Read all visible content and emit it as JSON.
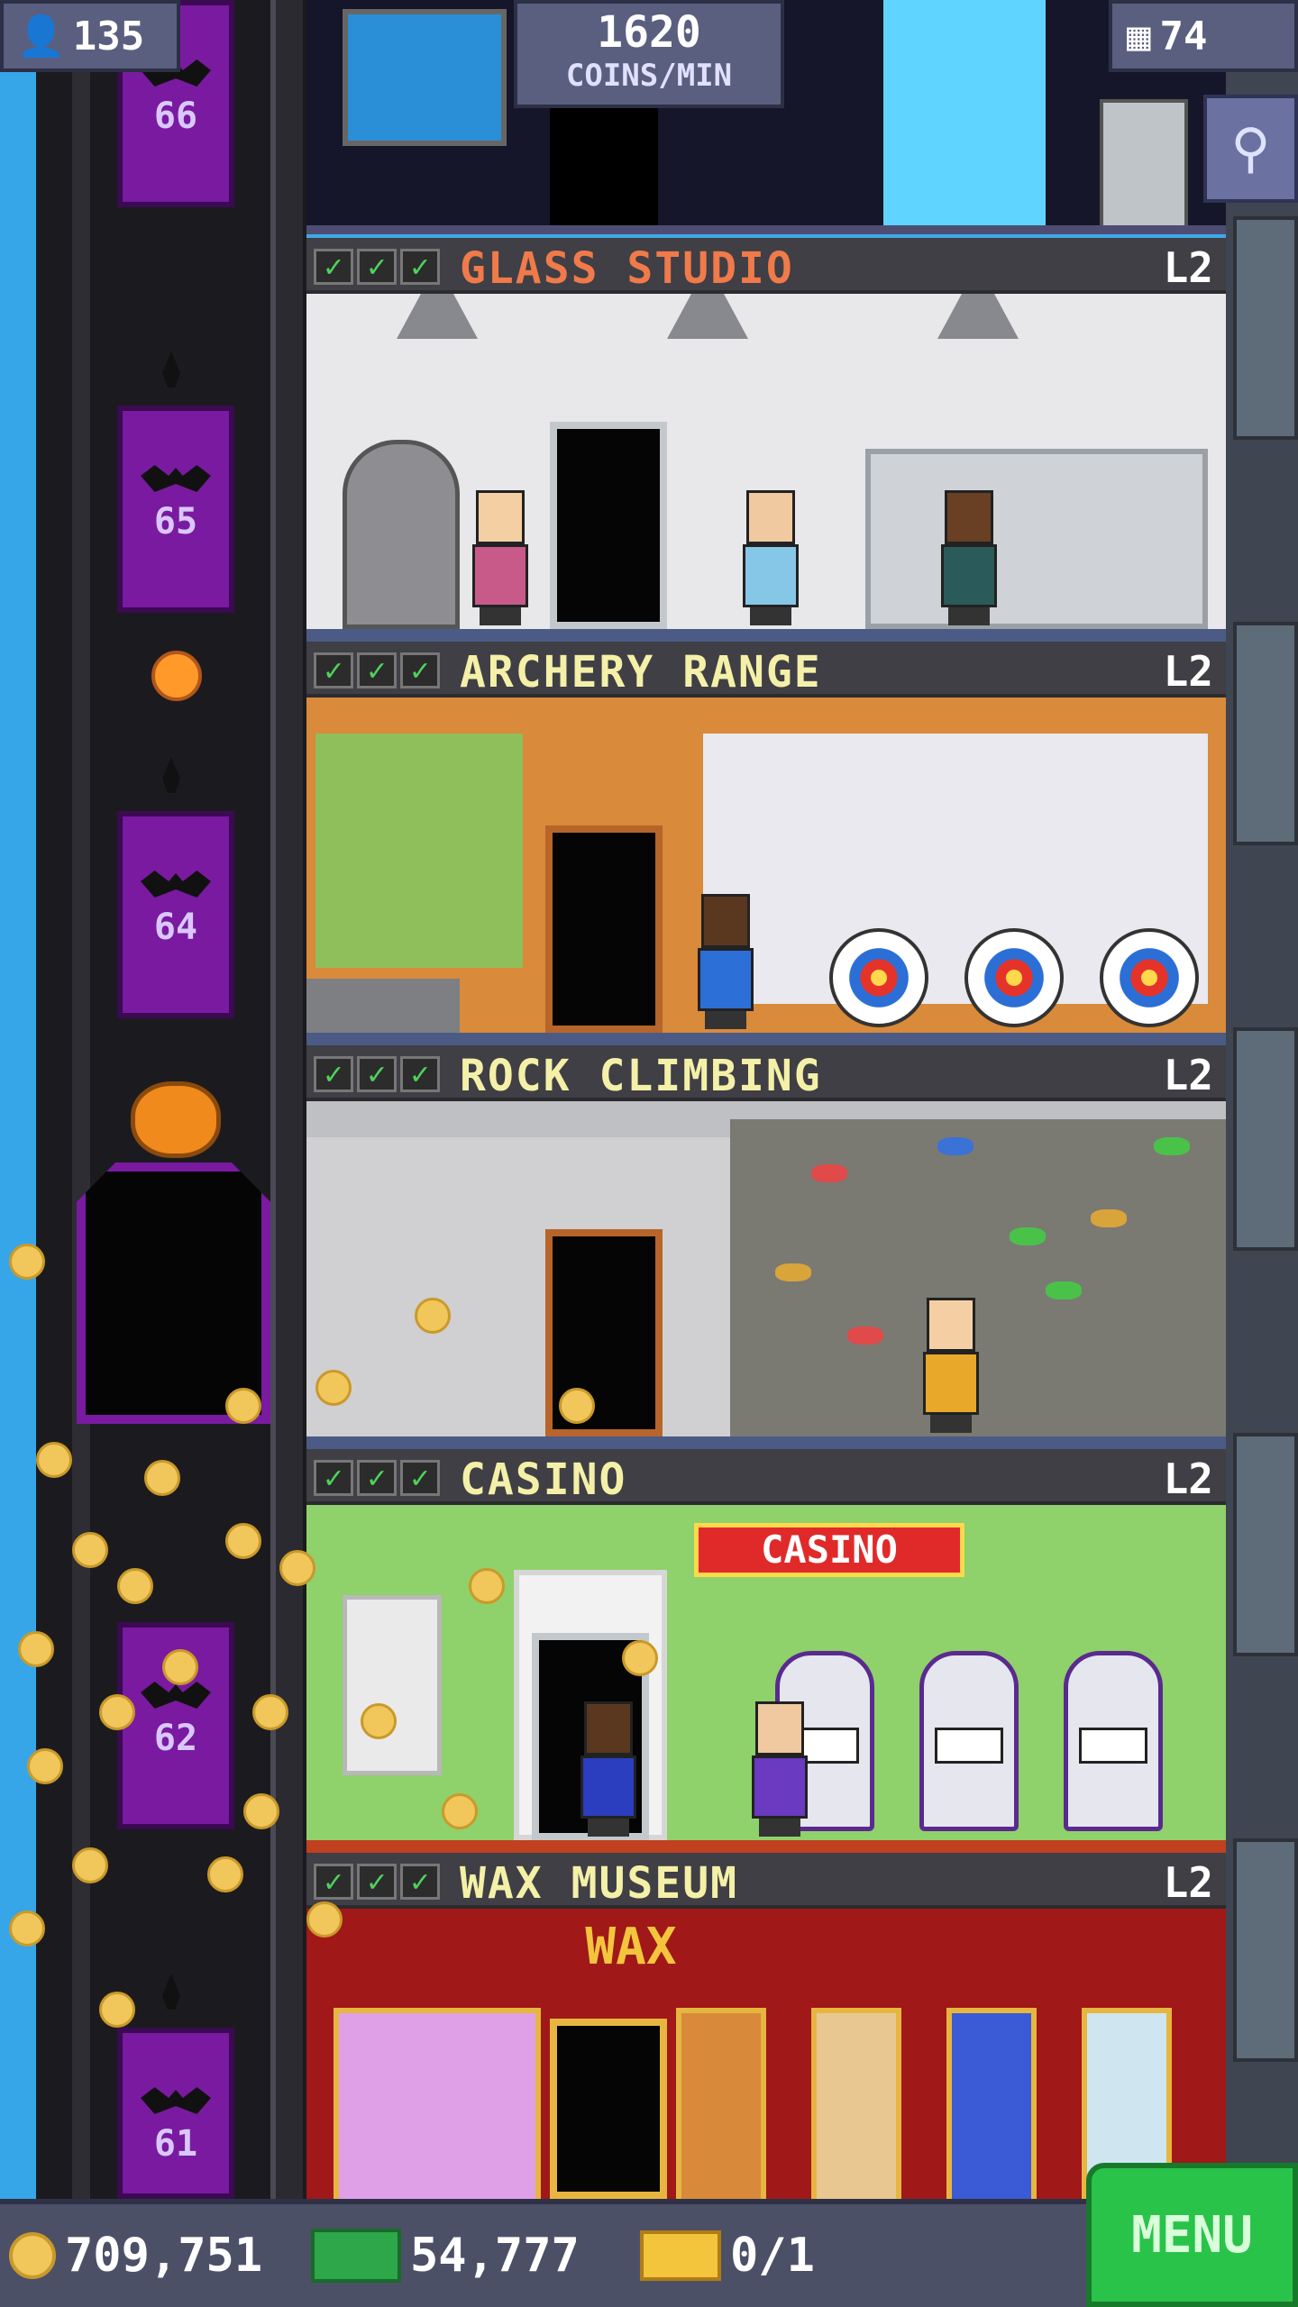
{
  "status": {
    "population": "135",
    "coin_rate_value": "1620",
    "coin_rate_label": "COINS/MIN",
    "floor_count": "74"
  },
  "elevator": {
    "floor_numbers": [
      "66",
      "65",
      "64",
      "62",
      "61"
    ]
  },
  "floors": [
    {
      "name": "GLASS STUDIO",
      "level": "L2",
      "name_color": "#f07a4a",
      "checks": 3
    },
    {
      "name": "ARCHERY RANGE",
      "level": "L2",
      "name_color": "#f4f0a8",
      "checks": 3
    },
    {
      "name": "ROCK CLIMBING",
      "level": "L2",
      "name_color": "#f4f0a8",
      "checks": 3
    },
    {
      "name": "CASINO",
      "level": "L2",
      "name_color": "#f4f0a8",
      "checks": 3,
      "sign": "CASINO"
    },
    {
      "name": "WAX MUSEUM",
      "level": "L2",
      "name_color": "#f4f0a8",
      "checks": 3,
      "sign": "WAX"
    }
  ],
  "bottom_bar": {
    "coins": "709,751",
    "bux": "54,777",
    "tickets": "0/1",
    "menu_label": "MENU"
  },
  "icons": {
    "population": "person-icon",
    "floors": "building-icon",
    "search": "magnifier-icon",
    "coin": "coin-icon",
    "bux": "tower-bux-icon",
    "ticket": "golden-ticket-icon"
  },
  "colors": {
    "check": "#4ed25c",
    "menu": "#29c34a",
    "elevator": "#7a1aa0"
  }
}
